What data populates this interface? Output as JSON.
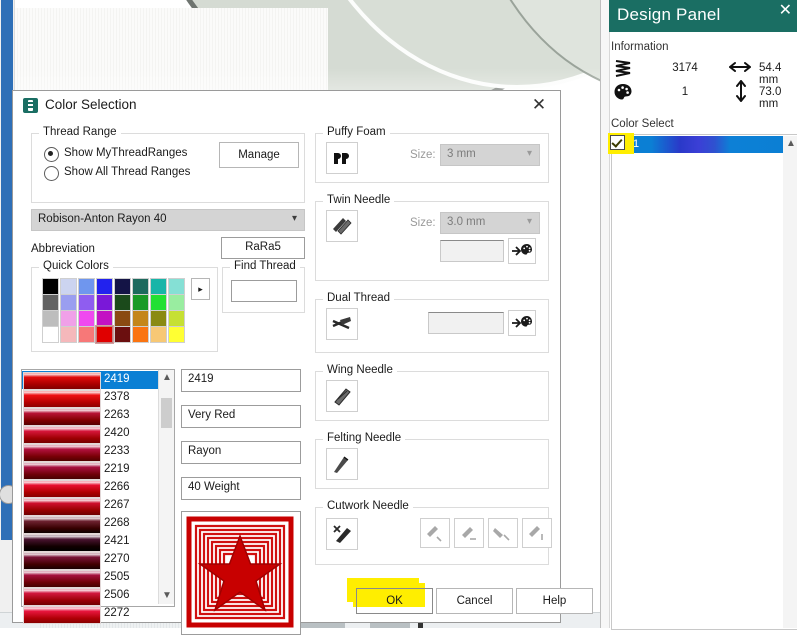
{
  "dialog": {
    "title": "Color Selection",
    "icon": "thread-spool-icon",
    "close": "✕",
    "thread_range": {
      "legend": "Thread Range",
      "radio_my": "Show MyThreadRanges",
      "radio_all": "Show All Thread Ranges",
      "radio_selected": "Show MyThreadRanges",
      "manage_button": "Manage",
      "range_combo_value": "Robison-Anton Rayon 40",
      "abbreviation_label": "Abbreviation",
      "abbreviation_value": "RaRa5"
    },
    "quick_colors": {
      "legend": "Quick Colors",
      "more_button": "▸",
      "selected_index": 27,
      "swatches": [
        "#000000",
        "#ccd4f0",
        "#6f96ee",
        "#2222ee",
        "#141446",
        "#1d6a5e",
        "#18b5a8",
        "#85e0d5",
        "#636363",
        "#9a9ef0",
        "#8f5df0",
        "#7a18d8",
        "#1b4a1b",
        "#1a9a28",
        "#22e033",
        "#99eda0",
        "#bdbdbd",
        "#f0a0e8",
        "#ef49ef",
        "#c312c3",
        "#8a4a12",
        "#c4861a",
        "#8a8a12",
        "#c6e033",
        "#ffffff",
        "#f5b8bb",
        "#f77878",
        "#e00000",
        "#6b0f0f",
        "#fa7411",
        "#f7c875",
        "#ffff33"
      ]
    },
    "find_thread": {
      "legend": "Find Thread",
      "value": "",
      "placeholder": ""
    },
    "thread_list": {
      "selected_code": "2419",
      "rows": [
        {
          "code": "2419",
          "color": "#e10c0c"
        },
        {
          "code": "2378",
          "color": "#ef0f14"
        },
        {
          "code": "2263",
          "color": "#b81436"
        },
        {
          "code": "2420",
          "color": "#d6163b"
        },
        {
          "code": "2233",
          "color": "#b2113f"
        },
        {
          "code": "2219",
          "color": "#a81041"
        },
        {
          "code": "2266",
          "color": "#e81030"
        },
        {
          "code": "2267",
          "color": "#cf0f2e"
        },
        {
          "code": "2268",
          "color": "#6e2230"
        },
        {
          "code": "2421",
          "color": "#4a1330"
        },
        {
          "code": "2270",
          "color": "#7a1338"
        },
        {
          "code": "2505",
          "color": "#a6123f"
        },
        {
          "code": "2506",
          "color": "#d2173f"
        },
        {
          "code": "2272",
          "color": "#e8163f"
        }
      ]
    },
    "details": {
      "code": "2419",
      "name": "Very Red",
      "type": "Rayon",
      "weight": "40 Weight"
    },
    "preview": {
      "alt": "star-design-preview",
      "fill_color": "#c80000"
    },
    "puffy_foam": {
      "legend": "Puffy Foam",
      "toggle_icon": "puffy-foam-icon",
      "size_label": "Size:",
      "size_value": "3 mm",
      "disabled": true
    },
    "twin_needle": {
      "legend": "Twin Needle",
      "toggle_icon": "twin-needle-icon",
      "size_label": "Size:",
      "size_value": "3.0 mm",
      "color_value": "",
      "palette_icon": "palette-icon",
      "disabled": true
    },
    "dual_thread": {
      "legend": "Dual Thread",
      "toggle_icon": "dual-thread-icon",
      "color_value": "",
      "palette_icon": "palette-icon"
    },
    "wing_needle": {
      "legend": "Wing Needle",
      "toggle_icon": "wing-needle-icon"
    },
    "felting_needle": {
      "legend": "Felting Needle",
      "toggle_icon": "felting-needle-icon"
    },
    "cutwork_needle": {
      "legend": "Cutwork Needle",
      "toggle_icon": "cutwork-needle-icon",
      "angle_buttons": [
        "cutwork-angle-1-icon",
        "cutwork-angle-2-icon",
        "cutwork-angle-3-icon",
        "cutwork-angle-4-icon"
      ]
    },
    "buttons": {
      "ok": "OK",
      "cancel": "Cancel",
      "help": "Help",
      "ok_highlight_color": "#ffee00"
    }
  },
  "design_panel": {
    "title": "Design Panel",
    "close": "✕",
    "information_label": "Information",
    "stitch_icon": "stitch-count-icon",
    "stitch_count": "3174",
    "palette_icon": "color-count-icon",
    "color_count": "1",
    "width_icon": "width-arrow-icon",
    "width_value": "54.4 mm",
    "height_icon": "height-arrow-icon",
    "height_value": "73.0 mm",
    "color_select_label": "Color Select",
    "color_rows": [
      {
        "index": "1",
        "checked": true,
        "color": "#2a39c9"
      }
    ],
    "highlight_color": "#ffee00"
  }
}
